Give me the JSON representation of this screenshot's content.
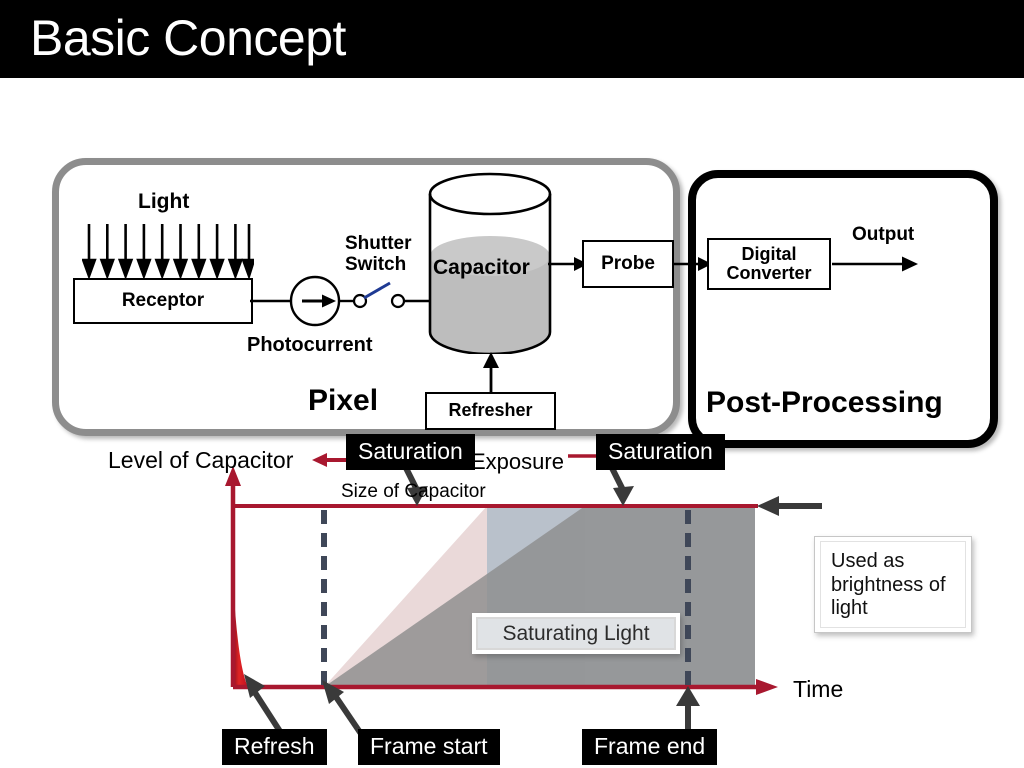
{
  "slide": {
    "title": "Basic Concept"
  },
  "colors": {
    "title_bar_bg": "#000000",
    "title_text": "#ffffff",
    "pixel_border": "#8d8d8d",
    "post_border": "#000000",
    "axis_red": "#a8182f",
    "ramp_pink": "#ead9d9",
    "ramp_gray": "#8d8d8d",
    "region_blue": "#b0bcc8",
    "refresh_red": "#e02020",
    "frame_line_navy": "#3f4758",
    "callout_bg": "#000000",
    "callout_text": "#ffffff"
  },
  "diagram": {
    "pixel_group_label": "Pixel",
    "post_group_label": "Post-Processing",
    "light_label": "Light",
    "light_arrow_count": 10,
    "receptor_label": "Receptor",
    "photocurrent_label": "Photocurrent",
    "shutter_label_line1": "Shutter",
    "shutter_label_line2": "Switch",
    "capacitor_label": "Capacitor",
    "capacitor_fill_percent": 55,
    "refresher_label": "Refresher",
    "probe_label": "Probe",
    "digital_converter_line1": "Digital",
    "digital_converter_line2": "Converter",
    "output_label": "Output"
  },
  "chart_data": {
    "type": "line",
    "title": "",
    "xlabel": "Time",
    "ylabel": "Level of Capacitor",
    "xlim": [
      0,
      1
    ],
    "ylim": [
      0,
      1
    ],
    "grid": false,
    "annotations": {
      "size_of_capacitor": "Size of Capacitor",
      "exposure": "Exposure",
      "saturation_left": "Saturation",
      "saturation_right": "Saturation",
      "refresh": "Refresh",
      "frame_start": "Frame start",
      "frame_end": "Frame end",
      "saturating_light": "Saturating Light",
      "note": "Used as brightness of light"
    },
    "events": {
      "refresh_x": 0.0,
      "frame_start_x": 0.168,
      "frame_end_x": 0.875,
      "saturation_line_y": 1.0
    },
    "series": [
      {
        "name": "Refresh decay",
        "type": "area",
        "color": "#e02020",
        "points": [
          [
            0.0,
            0.6
          ],
          [
            0.03,
            0.0
          ]
        ]
      },
      {
        "name": "Saturating Light",
        "type": "area",
        "color": "#ead9d9",
        "points": [
          [
            0.168,
            0.0
          ],
          [
            0.487,
            1.0
          ],
          [
            0.875,
            1.0
          ]
        ]
      },
      {
        "name": "Exposure ramp",
        "type": "area",
        "color": "#8d8d8d",
        "points": [
          [
            0.168,
            0.0
          ],
          [
            0.672,
            1.0
          ],
          [
            0.875,
            1.0
          ]
        ]
      }
    ]
  }
}
